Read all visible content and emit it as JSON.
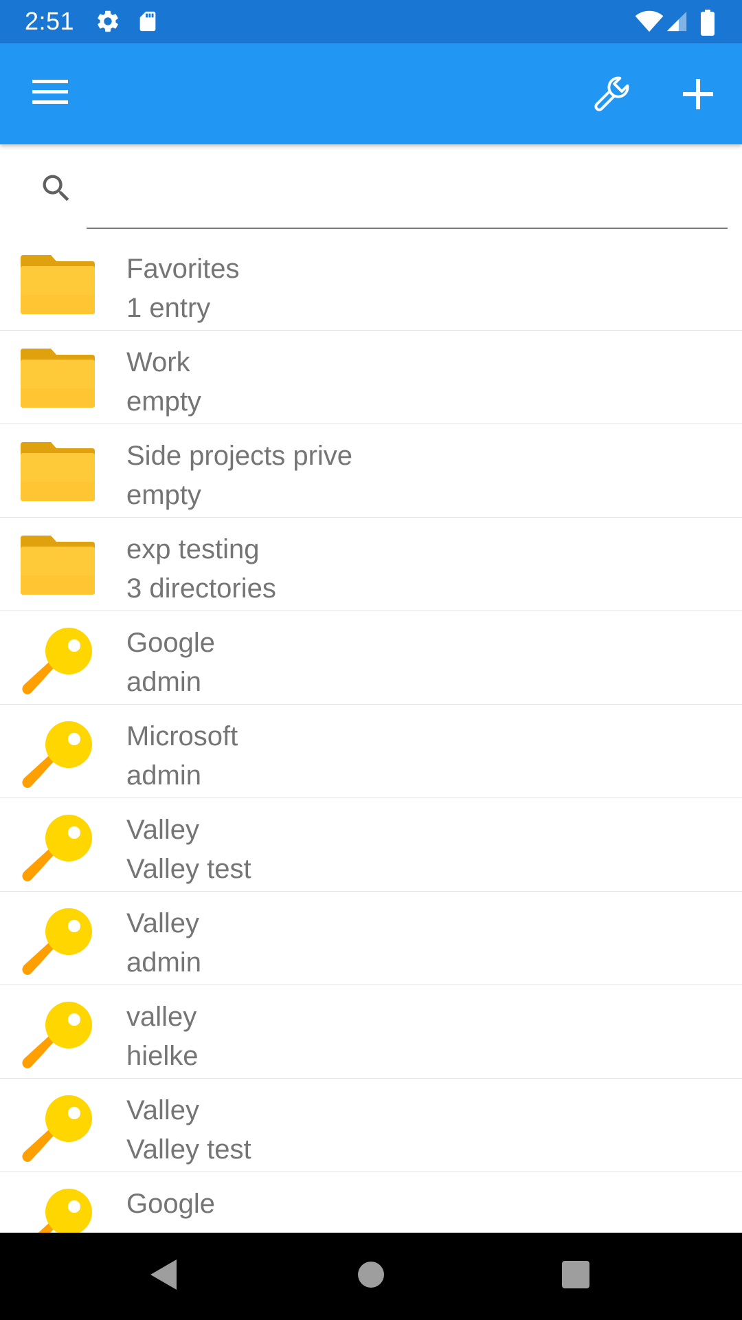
{
  "status_bar": {
    "time": "2:51",
    "icons": [
      "gear-icon",
      "sd-card-icon",
      "wifi-icon",
      "signal-icon",
      "battery-icon"
    ]
  },
  "app_bar": {
    "background": "#2196f3",
    "left_action": "menu-icon",
    "right_actions": [
      "wrench-icon",
      "plus-icon"
    ]
  },
  "search": {
    "value": "",
    "placeholder": ""
  },
  "entries": [
    {
      "type": "folder",
      "icon": "folder-icon",
      "title": "Favorites",
      "subtitle": "1 entry"
    },
    {
      "type": "folder",
      "icon": "folder-icon",
      "title": "Work",
      "subtitle": "empty"
    },
    {
      "type": "folder",
      "icon": "folder-icon",
      "title": "Side projects prive",
      "subtitle": "empty"
    },
    {
      "type": "folder",
      "icon": "folder-icon",
      "title": "exp testing",
      "subtitle": "3 directories"
    },
    {
      "type": "key",
      "icon": "key-icon",
      "title": "Google",
      "subtitle": "admin"
    },
    {
      "type": "key",
      "icon": "key-icon",
      "title": "Microsoft",
      "subtitle": "admin"
    },
    {
      "type": "key",
      "icon": "key-icon",
      "title": "Valley",
      "subtitle": "Valley test"
    },
    {
      "type": "key",
      "icon": "key-icon",
      "title": "Valley",
      "subtitle": "admin"
    },
    {
      "type": "key",
      "icon": "key-icon",
      "title": "valley",
      "subtitle": "hielke"
    },
    {
      "type": "key",
      "icon": "key-icon",
      "title": "Valley",
      "subtitle": "Valley test"
    },
    {
      "type": "key",
      "icon": "key-icon",
      "title": "Google",
      "subtitle": ""
    }
  ],
  "nav_bar": {
    "buttons": [
      "back-icon",
      "home-icon",
      "recents-icon"
    ]
  },
  "colors": {
    "status_bar": "#1976d2",
    "app_bar": "#2196f3",
    "folder": "#ffc93c",
    "key": "#ffd600",
    "text": "#757575"
  }
}
